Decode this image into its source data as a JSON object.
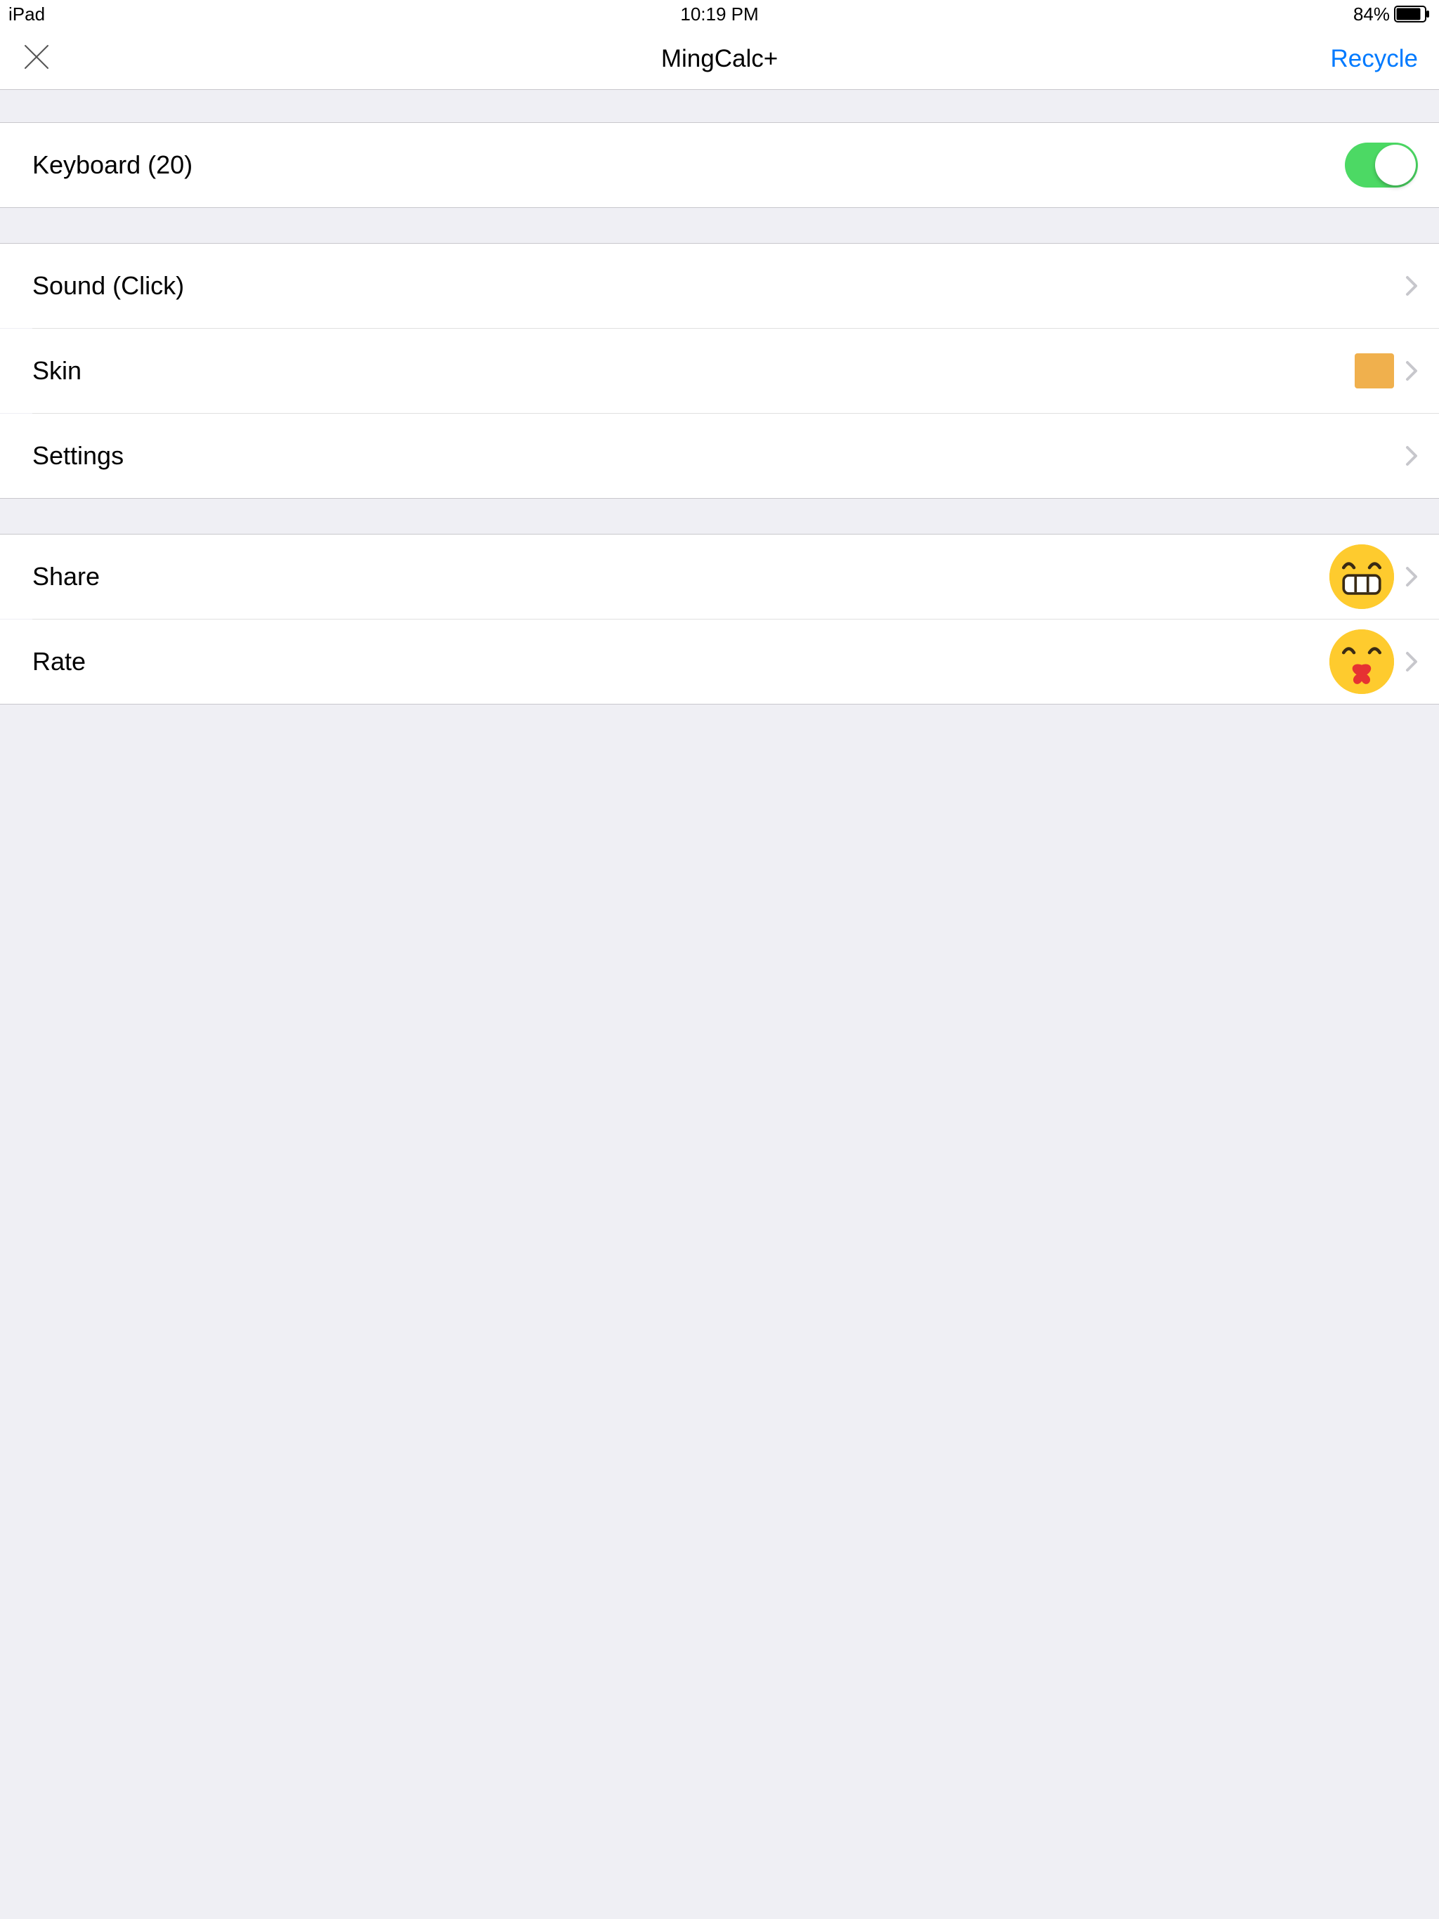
{
  "status": {
    "device": "iPad",
    "time": "10:19 PM",
    "battery_pct": "84%"
  },
  "nav": {
    "title": "MingCalc+",
    "recycle": "Recycle"
  },
  "rows": {
    "keyboard": "Keyboard (20)",
    "sound": "Sound (Click)",
    "skin": "Skin",
    "settings": "Settings",
    "share": "Share",
    "rate": "Rate"
  },
  "colors": {
    "skin_swatch": "#f0b04d",
    "accent": "#007aff",
    "switch_on": "#4cd964"
  },
  "toggles": {
    "keyboard_on": true
  }
}
